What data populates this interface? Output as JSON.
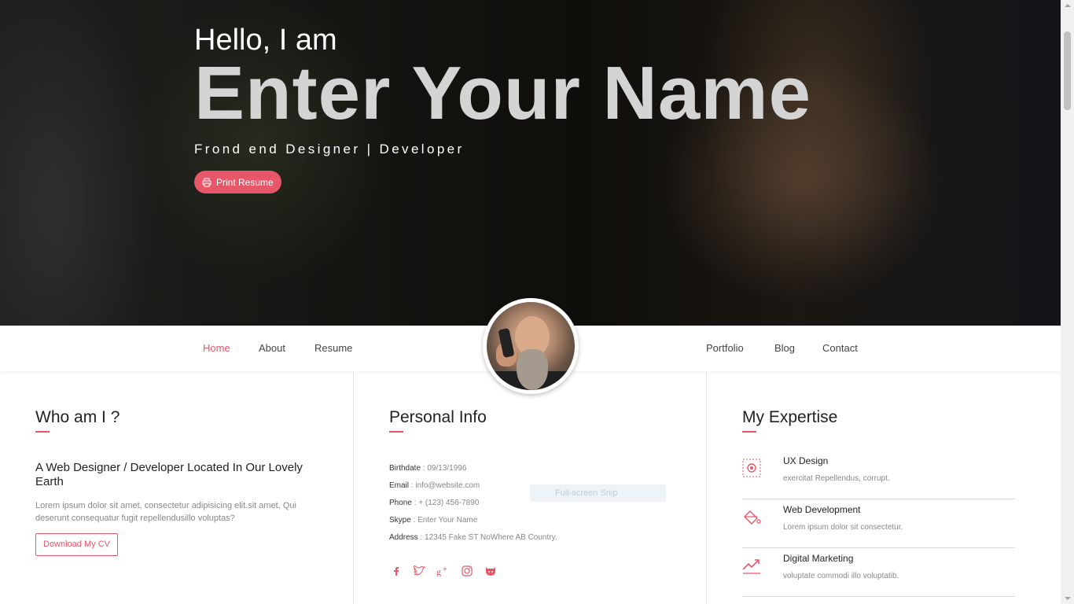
{
  "hero": {
    "greeting": "Hello, I am",
    "name": "Enter Your Name",
    "tagline": "Frond end Designer | Developer",
    "print_button": "Print Resume",
    "print_icon": "printer-icon"
  },
  "nav": {
    "left": [
      "Home",
      "About",
      "Resume"
    ],
    "right": [
      "Portfolio",
      "Blog",
      "Contact"
    ],
    "active": "Home"
  },
  "who": {
    "title": "Who am I ?",
    "subtitle": "A Web Designer / Developer Located In Our Lovely Earth",
    "text": "Lorem ipsum dolor sit amet, consectetur adipisicing elit.sit amet, Qui deserunt consequatur fugit repellendusillo voluptas?",
    "button": "Download My CV"
  },
  "info": {
    "title": "Personal Info",
    "rows": [
      {
        "key": "Birthdate",
        "value": "09/13/1996"
      },
      {
        "key": "Email",
        "value": "info@website.com"
      },
      {
        "key": "Phone",
        "value": "+ (123) 456-7890"
      },
      {
        "key": "Skype",
        "value": "Enter Your Name"
      },
      {
        "key": "Address",
        "value": "12345 Fake ST NoWhere AB Country."
      }
    ],
    "socials": [
      "facebook-icon",
      "twitter-icon",
      "google-plus-icon",
      "instagram-icon",
      "github-icon"
    ],
    "snip_label": "Full-screen Snip"
  },
  "expertise": {
    "title": "My Expertise",
    "items": [
      {
        "title": "UX Design",
        "desc": "exercitat Repellendus, corrupt.",
        "icon": "gear-icon"
      },
      {
        "title": "Web Development",
        "desc": "Lorem ipsum dolor sit consectetur.",
        "icon": "paint-bucket-icon"
      },
      {
        "title": "Digital Marketing",
        "desc": "voluptate commodi illo voluptatib.",
        "icon": "trending-up-icon"
      }
    ]
  },
  "colors": {
    "accent": "#e8566a",
    "hero_name": "#d4d4d4"
  }
}
